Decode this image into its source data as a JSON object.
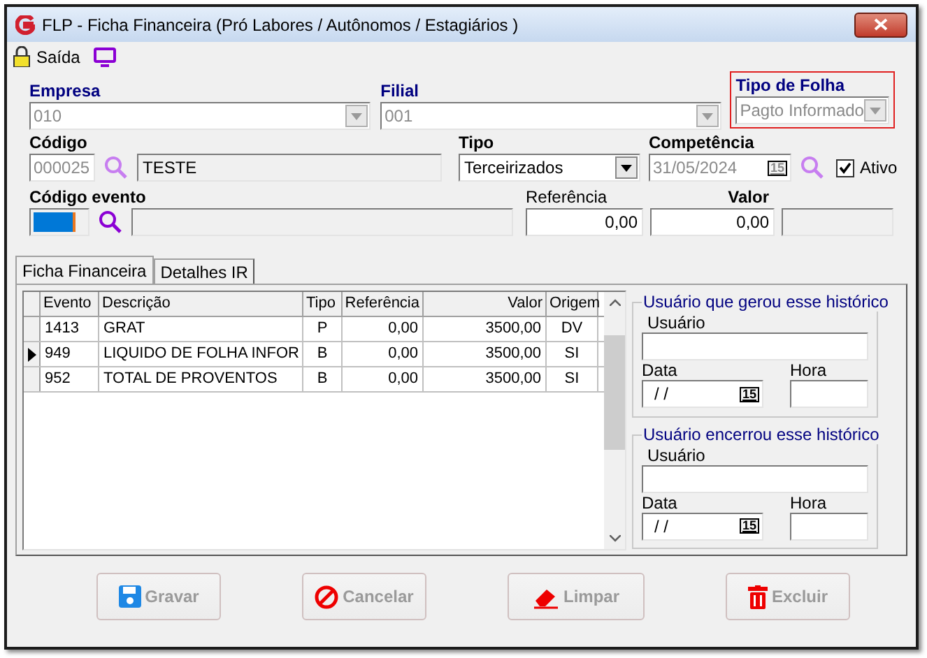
{
  "window": {
    "title": "FLP - Ficha Financeira (Pró Labores / Autônomos / Estagiários )"
  },
  "toolbar": {
    "exit_label": "Saída"
  },
  "header_fields": [
    {
      "label": "Empresa",
      "value": "010",
      "highlighted": false
    },
    {
      "label": "Filial",
      "value": "001",
      "highlighted": false
    },
    {
      "label": "Tipo de Folha",
      "value": "Pagto Informado",
      "highlighted": true
    }
  ],
  "employee": {
    "code_label": "Código",
    "code": "000025",
    "name": "TESTE",
    "type_label": "Tipo",
    "type": "Terceirizados",
    "period_label": "Competência",
    "period": "31/05/2024",
    "calendar_glyph": "15",
    "active_label": "Ativo",
    "active": true
  },
  "event": {
    "code_label": "Código evento",
    "reference_label": "Referência",
    "reference": "0,00",
    "value_label": "Valor",
    "value": "0,00"
  },
  "tabs": [
    {
      "label": "Ficha Financeira",
      "selected": true
    },
    {
      "label": "Detalhes IR",
      "selected": false
    }
  ],
  "table": {
    "columns": [
      "Evento",
      "Descrição",
      "Tipo",
      "Referência",
      "Valor",
      "Origem"
    ],
    "rows": [
      {
        "cells": [
          "1413",
          "GRAT",
          "P",
          "0,00",
          "3500,00",
          "DV"
        ],
        "selected": false
      },
      {
        "cells": [
          "949",
          "LIQUIDO DE FOLHA INFOR",
          "B",
          "0,00",
          "3500,00",
          "SI"
        ],
        "selected": true
      },
      {
        "cells": [
          "952",
          "TOTAL DE PROVENTOS",
          "B",
          "0,00",
          "3500,00",
          "SI"
        ],
        "selected": false
      }
    ]
  },
  "history_groups": [
    {
      "title": "Usuário que gerou esse histórico",
      "user_label": "Usuário",
      "date_label": "Data",
      "date": "/ /",
      "calendar_glyph": "15",
      "time_label": "Hora"
    },
    {
      "title": "Usuário encerrou esse histórico",
      "user_label": "Usuário",
      "date_label": "Data",
      "date": "/ /",
      "calendar_glyph": "15",
      "time_label": "Hora"
    }
  ],
  "buttons": [
    {
      "label": "Gravar",
      "kind": "save",
      "disabled": true
    },
    {
      "label": "Cancelar",
      "kind": "cancel",
      "disabled": true
    },
    {
      "label": "Limpar",
      "kind": "clear",
      "disabled": true
    },
    {
      "label": "Excluir",
      "kind": "delete",
      "disabled": true
    }
  ]
}
